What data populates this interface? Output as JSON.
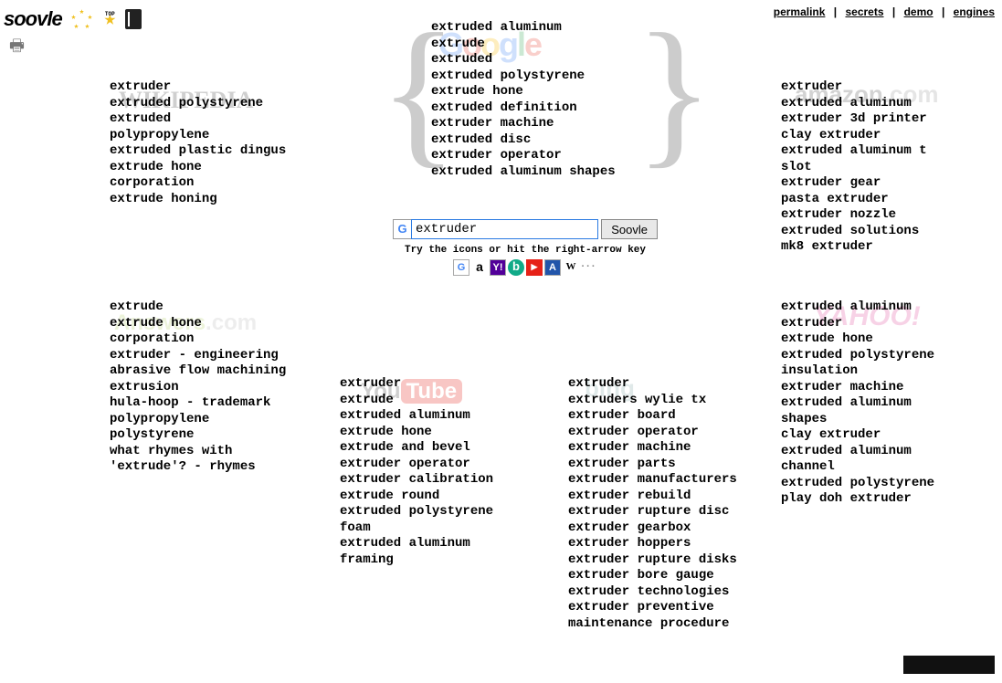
{
  "logo": "soovle",
  "toplinks": {
    "permalink": "permalink",
    "secrets": "secrets",
    "demo": "demo",
    "engines": "engines"
  },
  "search": {
    "value": "extruder",
    "button": "Soovle",
    "tip": "Try the icons or hit the right-arrow key"
  },
  "engines": [
    "G",
    "a",
    "Y!",
    "b",
    "▶",
    "A",
    "W",
    "···"
  ],
  "google": [
    "extruded aluminum",
    "extrude",
    "extruded",
    "extruded polystyrene",
    "extrude hone",
    "extruded definition",
    "extruder machine",
    "extruded disc",
    "extruder operator",
    "extruded aluminum shapes"
  ],
  "wikipedia": [
    "extruder",
    "extruded polystyrene",
    "extruded",
    "polypropylene",
    "extruded plastic dingus",
    "extrude hone corporation",
    "extrude honing"
  ],
  "amazon": [
    "extruder",
    "extruded aluminum",
    "extruder 3d printer",
    "clay extruder",
    "extruded aluminum t slot",
    "extruder gear",
    "pasta extruder",
    "extruder nozzle",
    "extruded solutions",
    "mk8 extruder"
  ],
  "answers": [
    "extrude",
    "extrude hone corporation",
    "extruder - engineering",
    "abrasive flow machining",
    "extrusion",
    "hula-hoop - trademark",
    "polypropylene",
    "polystyrene",
    "what rhymes with 'extrude'? - rhymes"
  ],
  "youtube": [
    "extruder",
    "extrude",
    "extruded aluminum",
    "extrude hone",
    "extrude and bevel",
    "extruder operator",
    "extruder calibration",
    "extrude round",
    "extruded polystyrene foam",
    "extruded aluminum framing"
  ],
  "bing": [
    "extruder",
    "extruders wylie tx",
    "extruder board",
    "extruder operator",
    "extruder machine",
    "extruder parts",
    "extruder manufacturers",
    "extruder rebuild",
    "extruder rupture disc",
    "extruder gearbox",
    "extruder hoppers",
    "extruder rupture disks",
    "extruder bore gauge",
    "extruder technologies",
    "extruder preventive maintenance procedure"
  ],
  "yahoo": [
    "extruded aluminum",
    "extruder",
    "extrude hone",
    "extruded polystyrene insulation",
    "extruder machine",
    "extruded aluminum shapes",
    "clay extruder",
    "extruded aluminum channel",
    "extruded polystyrene",
    "play doh extruder"
  ]
}
